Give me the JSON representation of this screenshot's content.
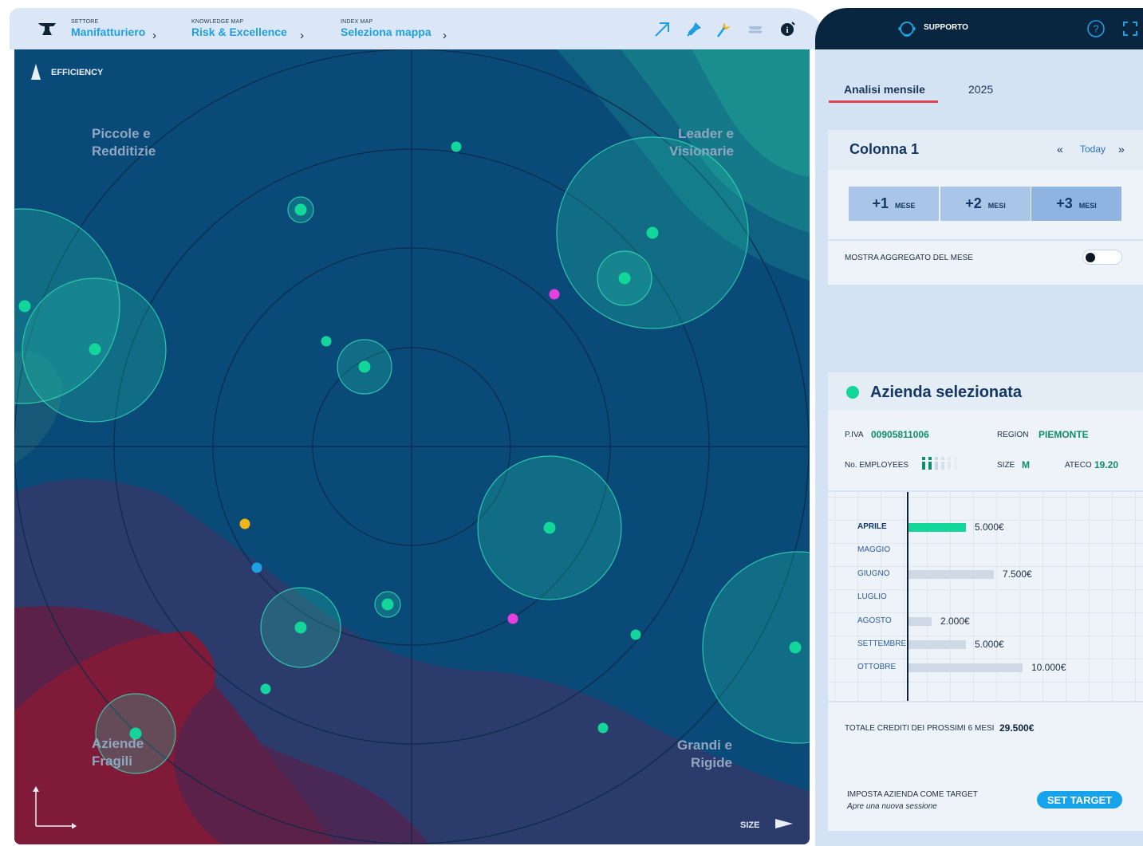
{
  "breadcrumbs": [
    {
      "small": "SETTORE",
      "big": "Manifatturiero"
    },
    {
      "small": "KNOWLEDGE MAP",
      "big": "Risk & Excellence"
    },
    {
      "small": "INDEX MAP",
      "big": "Seleziona mappa"
    }
  ],
  "support_label": "SUPPORTO",
  "map": {
    "axis_y_label": "EFFICIENCY",
    "axis_x_label": "SIZE",
    "quadrants": {
      "top_left": "Piccole e Redditizie",
      "top_right": "Leader e Visionarie",
      "bottom_left": "Aziende Fragili",
      "bottom_right": "Grandi e Rigide"
    }
  },
  "tabs": [
    "Analisi mensile",
    "2025"
  ],
  "column": {
    "title": "Colonna 1",
    "today_label": "Today",
    "month_buttons": [
      {
        "num": "+1",
        "unit": "MESE"
      },
      {
        "num": "+2",
        "unit": "MESI"
      },
      {
        "num": "+3",
        "unit": "MESI"
      }
    ],
    "toggle_label": "MOSTRA AGGREGATO DEL MESE",
    "toggle_on": false
  },
  "company": {
    "title": "Azienda selezionata",
    "piva_label": "P.IVA",
    "piva": "00905811006",
    "region_label": "REGION",
    "region": "PIEMONTE",
    "employees_label": "No. EMPLOYEES",
    "employees_level": 0.33,
    "size_label": "SIZE",
    "size": "M",
    "ateco_label": "ATECO",
    "ateco": "19.20",
    "months": [
      {
        "name": "APRILE",
        "value": 5000,
        "label": "5.000€",
        "active": true
      },
      {
        "name": "MAGGIO",
        "value": 0,
        "label": "",
        "active": false
      },
      {
        "name": "GIUGNO",
        "value": 7500,
        "label": "7.500€",
        "active": false
      },
      {
        "name": "LUGLIO",
        "value": 0,
        "label": "",
        "active": false
      },
      {
        "name": "AGOSTO",
        "value": 2000,
        "label": "2.000€",
        "active": false
      },
      {
        "name": "SETTEMBRE",
        "value": 5000,
        "label": "5.000€",
        "active": false
      },
      {
        "name": "OTTOBRE",
        "value": 10000,
        "label": "10.000€",
        "active": false
      }
    ],
    "total_label": "TOTALE CREDITI DEI PROSSIMI 6 MESI",
    "total": "29.500€",
    "target_label": "IMPOSTA AZIENDA COME TARGET",
    "target_sub": "Apre una nuova sessione",
    "set_target": "SET TARGET"
  },
  "colors": {
    "accent": "#1e9fe0",
    "green": "#12d69a",
    "dark": "#08263f",
    "red": "#e0424f"
  }
}
